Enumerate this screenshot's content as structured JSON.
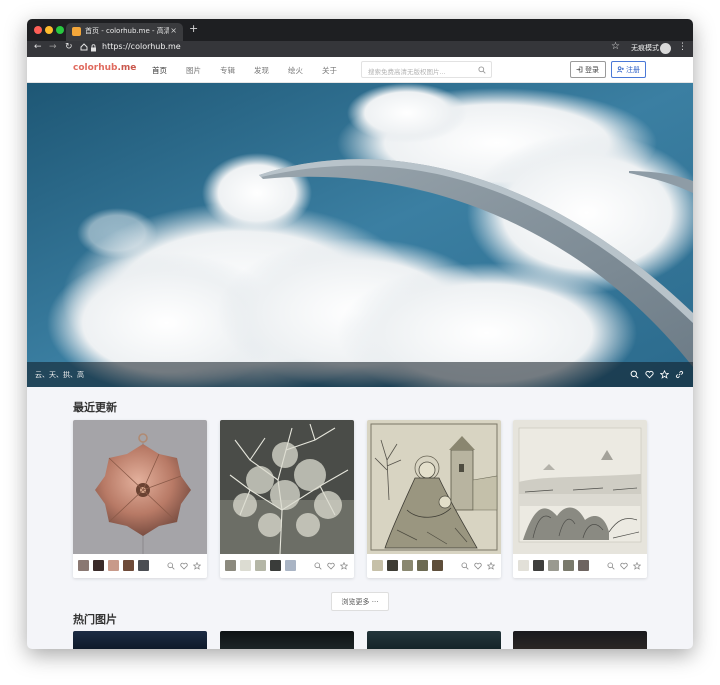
{
  "browser": {
    "tab_title": "首页 - colorhub.me - 高清无版权",
    "tab_close": "×",
    "new_tab": "+",
    "url": "https://colorhub.me",
    "incognito_label": "无痕模式",
    "icons": [
      "back-icon",
      "forward-icon",
      "reload-icon",
      "home-icon",
      "lock-icon",
      "bookmark-star-icon",
      "menu-icon"
    ]
  },
  "site": {
    "logo_main": "colorhub",
    "logo_tld": ".me",
    "nav": [
      "首页",
      "图片",
      "专辑",
      "发现",
      "绘火",
      "关于"
    ],
    "search_placeholder": "搜索免费高清无版权图片...",
    "login_label": "登录",
    "register_label": "注册"
  },
  "hero": {
    "tags": "云、天、拱、高",
    "icons": [
      "search-icon",
      "heart-icon",
      "star-icon",
      "link-icon"
    ]
  },
  "recent": {
    "title": "最近更新",
    "cards": [
      {
        "palette": [
          "#8a7872",
          "#3a2b29",
          "#c89a8a",
          "#6e4a38",
          "#4b4d52"
        ]
      },
      {
        "palette": [
          "#8c8a7e",
          "#dcdcd2",
          "#b4b6a6",
          "#3a3c3a",
          "#a9b4c4"
        ]
      },
      {
        "palette": [
          "#c6c0a8",
          "#3e3c34",
          "#8a8870",
          "#6c6a52",
          "#5e4e3a"
        ]
      },
      {
        "palette": [
          "#e2e0d8",
          "#3e3e3c",
          "#9a9a90",
          "#7a7a6c",
          "#6e6460"
        ]
      }
    ],
    "more_label": "浏览更多 ···"
  },
  "popular": {
    "title": "热门图片"
  }
}
